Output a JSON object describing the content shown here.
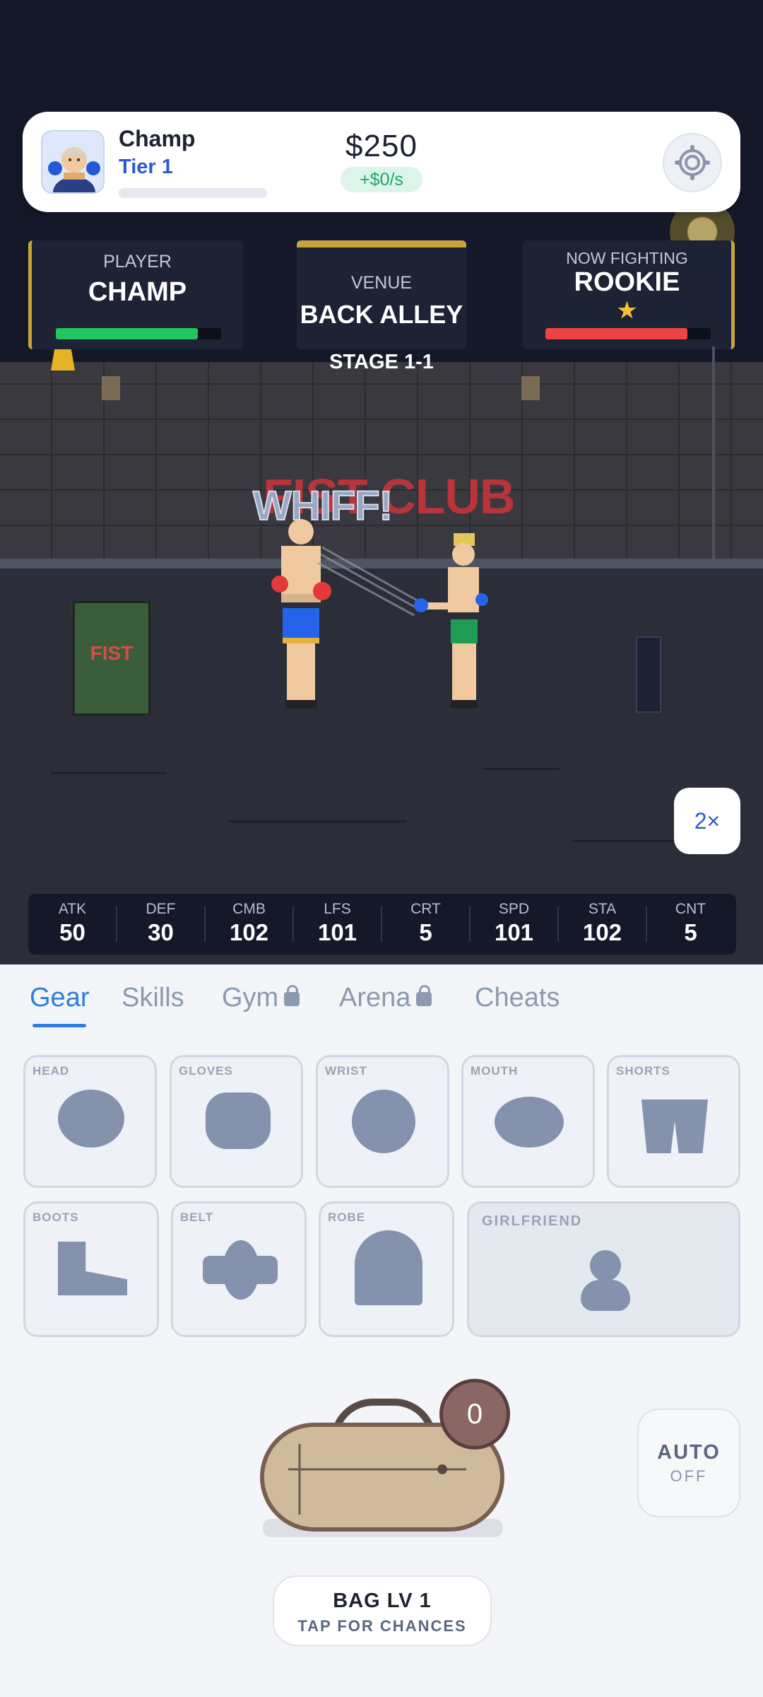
{
  "header": {
    "player_name": "Champ",
    "tier": "Tier 1",
    "xp_progress": 0,
    "money": "$250",
    "income_rate": "+$0/s",
    "settings_icon": "gear-icon"
  },
  "panels": {
    "player": {
      "label": "PLAYER",
      "name": "CHAMP",
      "hp_fraction": 0.86
    },
    "venue": {
      "label": "VENUE",
      "name": "BACK ALLEY"
    },
    "enemy": {
      "label": "NOW FIGHTING",
      "name": "ROOKIE",
      "stars": "★",
      "hp_fraction": 0.86
    }
  },
  "stage": "STAGE 1-1",
  "arena": {
    "club_sign": "FIST CLUB",
    "hit_text": "WHIFF!",
    "trash_label": "FIST"
  },
  "speed_button": "2×",
  "stats": [
    {
      "label": "ATK",
      "value": "50"
    },
    {
      "label": "DEF",
      "value": "30"
    },
    {
      "label": "CMB",
      "value": "102"
    },
    {
      "label": "LFS",
      "value": "101"
    },
    {
      "label": "CRT",
      "value": "5"
    },
    {
      "label": "SPD",
      "value": "101"
    },
    {
      "label": "STA",
      "value": "102"
    },
    {
      "label": "CNT",
      "value": "5"
    }
  ],
  "tabs": [
    {
      "label": "Gear",
      "active": true,
      "locked": false
    },
    {
      "label": "Skills",
      "active": false,
      "locked": false
    },
    {
      "label": "Gym",
      "active": false,
      "locked": true
    },
    {
      "label": "Arena",
      "active": false,
      "locked": true
    },
    {
      "label": "Cheats",
      "active": false,
      "locked": false
    }
  ],
  "gear_slots": [
    {
      "label": "HEAD"
    },
    {
      "label": "GLOVES"
    },
    {
      "label": "WRIST"
    },
    {
      "label": "MOUTH"
    },
    {
      "label": "SHORTS"
    },
    {
      "label": "BOOTS"
    },
    {
      "label": "BELT"
    },
    {
      "label": "ROBE"
    },
    {
      "label": "GIRLFRIEND"
    }
  ],
  "bag": {
    "count": "0",
    "level_label": "BAG LV 1",
    "subtitle": "TAP FOR CHANCES"
  },
  "auto": {
    "label": "AUTO",
    "state": "OFF"
  },
  "colors": {
    "accent": "#2f7de1",
    "gold": "#c9a43b",
    "player_hp": "#22c55e",
    "enemy_hp": "#ef4444"
  }
}
